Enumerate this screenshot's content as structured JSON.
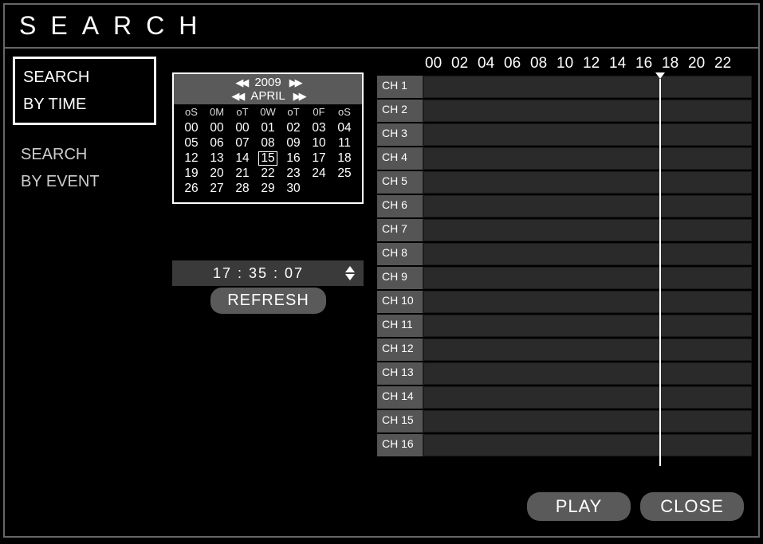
{
  "title": "SEARCH",
  "sidebar": {
    "items": [
      {
        "label": "SEARCH\nBY TIME",
        "active": true
      },
      {
        "label": "SEARCH\nBY EVENT",
        "active": false
      }
    ]
  },
  "calendar": {
    "year": "2009",
    "month": "APRIL",
    "dow": [
      "oS",
      "0M",
      "oT",
      "0W",
      "oT",
      "0F",
      "oS"
    ],
    "days": [
      "00",
      "00",
      "00",
      "01",
      "02",
      "03",
      "04",
      "05",
      "06",
      "07",
      "08",
      "09",
      "10",
      "11",
      "12",
      "13",
      "14",
      "15",
      "16",
      "17",
      "18",
      "19",
      "20",
      "21",
      "22",
      "23",
      "24",
      "25",
      "26",
      "27",
      "28",
      "29",
      "30"
    ],
    "selected_day": "15"
  },
  "time_value": "17 : 35 : 07",
  "refresh_label": "REFRESH",
  "timeline": {
    "hours": [
      "00",
      "02",
      "04",
      "06",
      "08",
      "10",
      "12",
      "14",
      "16",
      "18",
      "20",
      "22"
    ],
    "channels": [
      "CH 1",
      "CH 2",
      "CH 3",
      "CH 4",
      "CH 5",
      "CH 6",
      "CH 7",
      "CH 8",
      "CH 9",
      "CH 10",
      "CH 11",
      "CH 12",
      "CH 13",
      "CH 14",
      "CH 15",
      "CH 16"
    ],
    "playhead_hour": 17.6
  },
  "buttons": {
    "play": "PLAY",
    "close": "CLOSE"
  }
}
